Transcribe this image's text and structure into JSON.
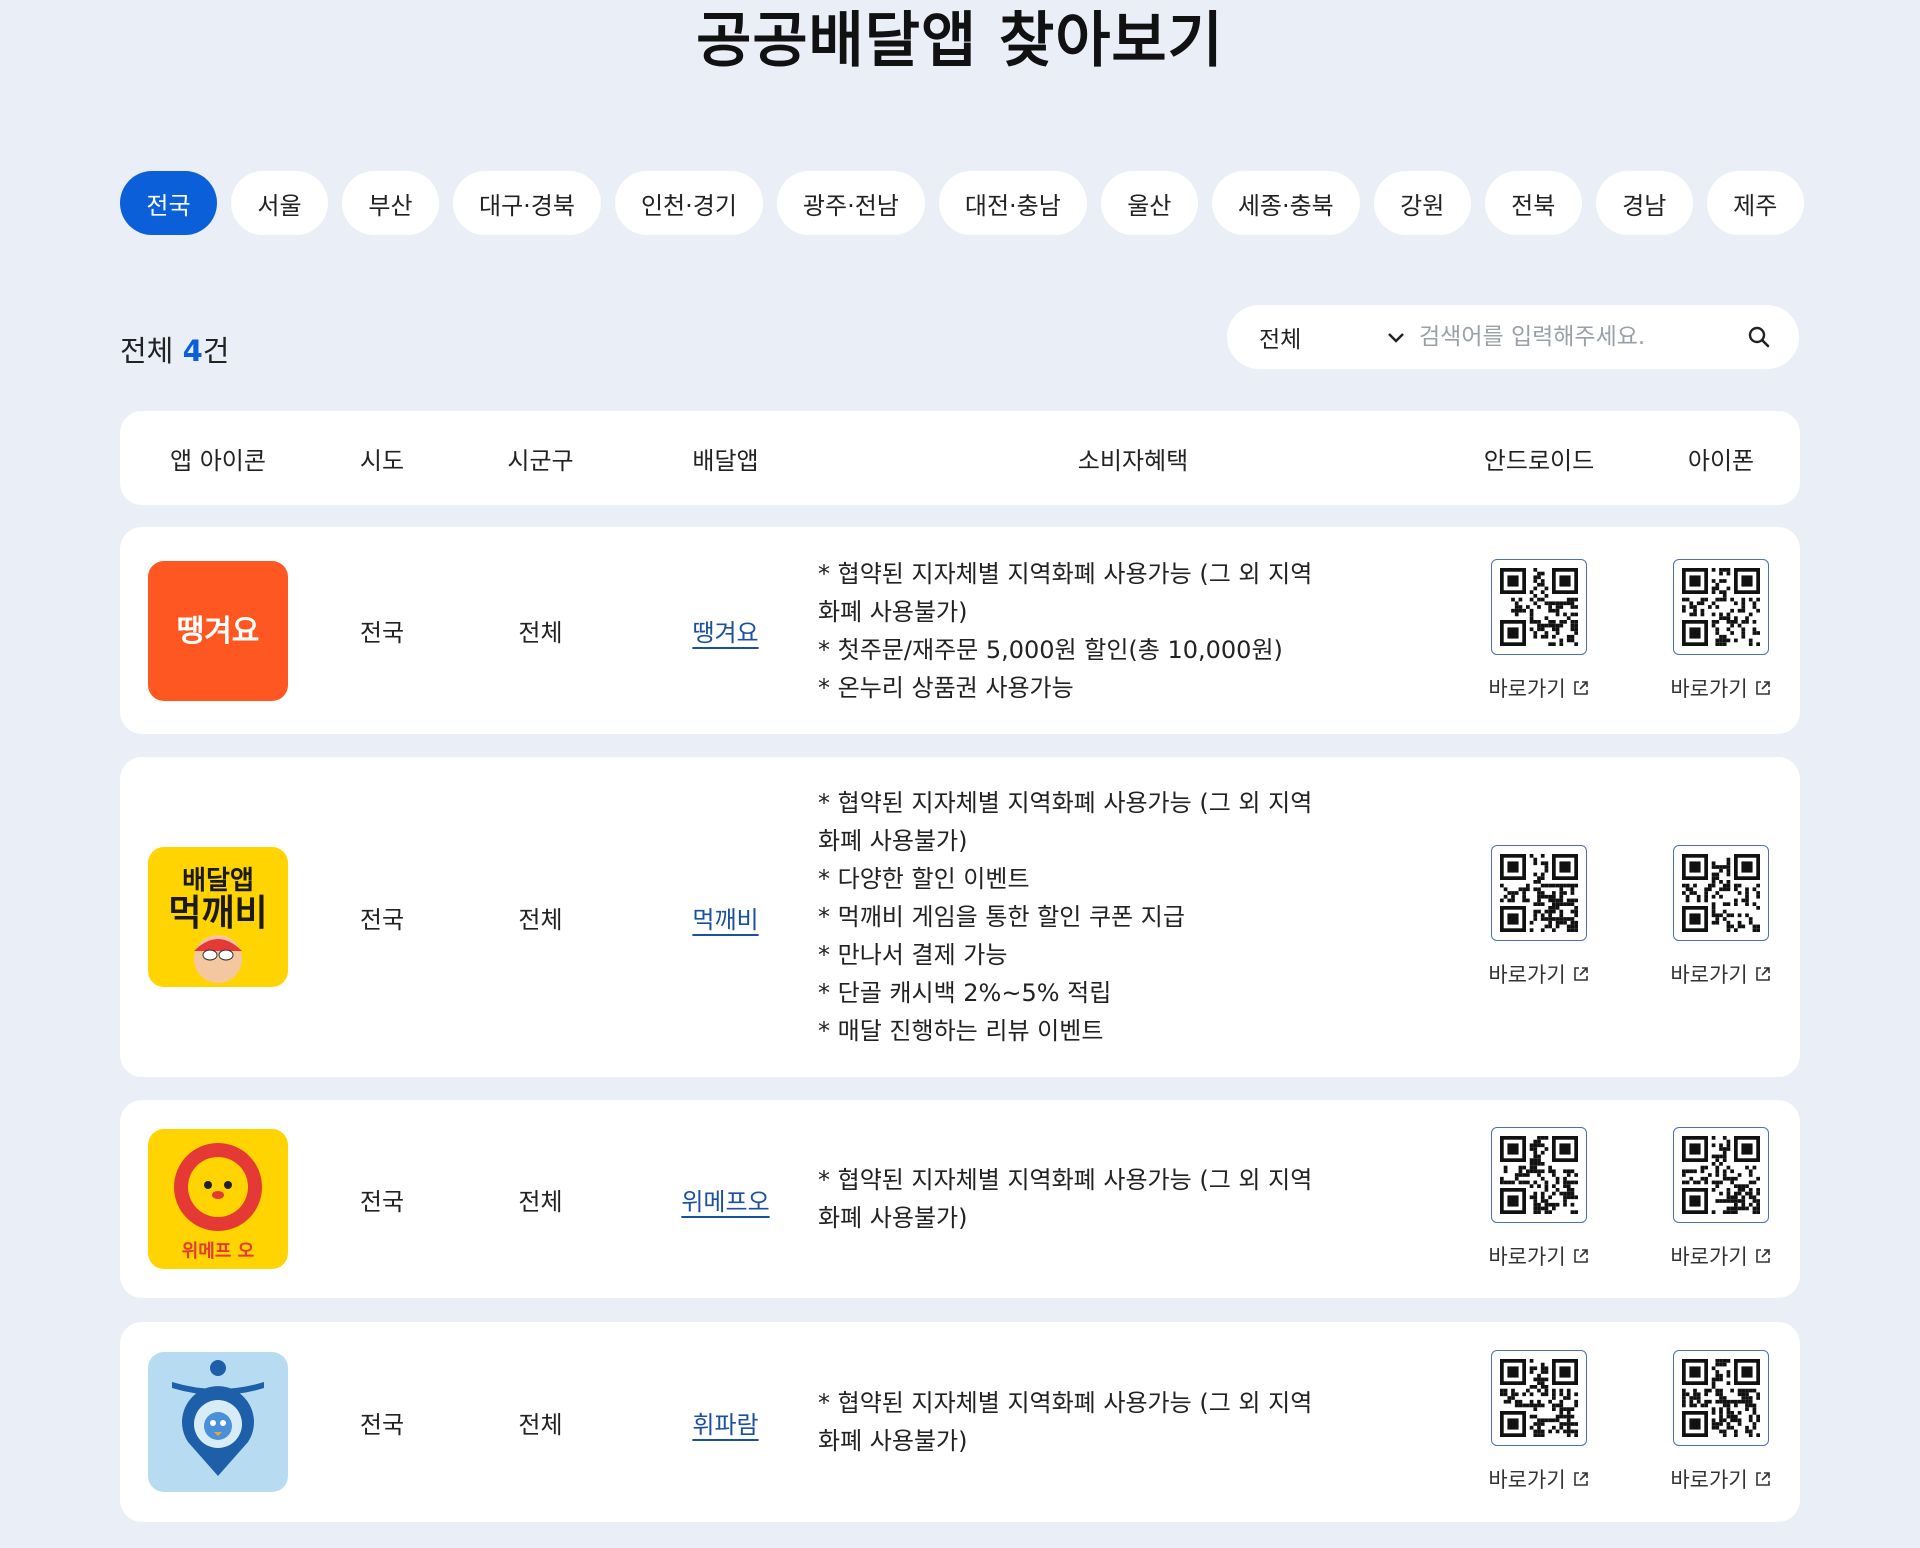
{
  "page": {
    "title": "공공배달앱 찾아보기"
  },
  "regions": {
    "items": [
      "전국",
      "서울",
      "부산",
      "대구·경북",
      "인천·경기",
      "광주·전남",
      "대전·충남",
      "울산",
      "세종·충북",
      "강원",
      "전북",
      "경남",
      "제주"
    ],
    "active": "전국"
  },
  "summary": {
    "prefix": "전체 ",
    "count": "4",
    "suffix": "건"
  },
  "search": {
    "select_value": "전체",
    "placeholder": "검색어를 입력해주세요.",
    "icons": {
      "dropdown": "chevron-down-icon",
      "search": "search-icon"
    }
  },
  "table": {
    "headers": {
      "icon": "앱 아이콘",
      "sido": "시도",
      "sigungu": "시군구",
      "app": "배달앱",
      "benefit": "소비자혜택",
      "android": "안드로이드",
      "iphone": "아이폰"
    },
    "go_label": "바로가기",
    "rows": [
      {
        "icon_text": "땡겨요",
        "icon_bg": "#ff5722",
        "sido": "전국",
        "sigungu": "전체",
        "app": "땡겨요",
        "benefits": [
          "* 협약된 지자체별 지역화폐 사용가능 (그 외 지역화폐 사용불가)",
          "* 첫주문/재주문 5,000원 할인(총 10,000원)",
          "* 온누리 상품권 사용가능"
        ]
      },
      {
        "icon_text_top": "배달앱",
        "icon_text_main": "먹깨비",
        "icon_bg": "#ffd400",
        "sido": "전국",
        "sigungu": "전체",
        "app": "먹깨비",
        "benefits": [
          "* 협약된 지자체별 지역화폐 사용가능 (그 외 지역화폐 사용불가)",
          "* 다양한 할인 이벤트",
          "* 먹깨비 게임을 통한 할인 쿠폰 지급",
          "* 만나서 결제 가능",
          "* 단골 캐시백 2%~5% 적립",
          "* 매달 진행하는 리뷰 이벤트"
        ]
      },
      {
        "icon_text": "위메프 오",
        "icon_bg": "#ffd400",
        "sido": "전국",
        "sigungu": "전체",
        "app": "위메프오",
        "benefits": [
          "* 협약된 지자체별 지역화폐 사용가능 (그 외 지역화폐 사용불가)"
        ]
      },
      {
        "icon_bg": "#b7dcf2",
        "sido": "전국",
        "sigungu": "전체",
        "app": "휘파람",
        "benefits": [
          "* 협약된 지자체별 지역화폐 사용가능 (그 외 지역화폐 사용불가)"
        ]
      }
    ]
  },
  "colors": {
    "accent": "#0b5fd8",
    "background": "#eaeff7",
    "link": "#1b4fa0"
  }
}
